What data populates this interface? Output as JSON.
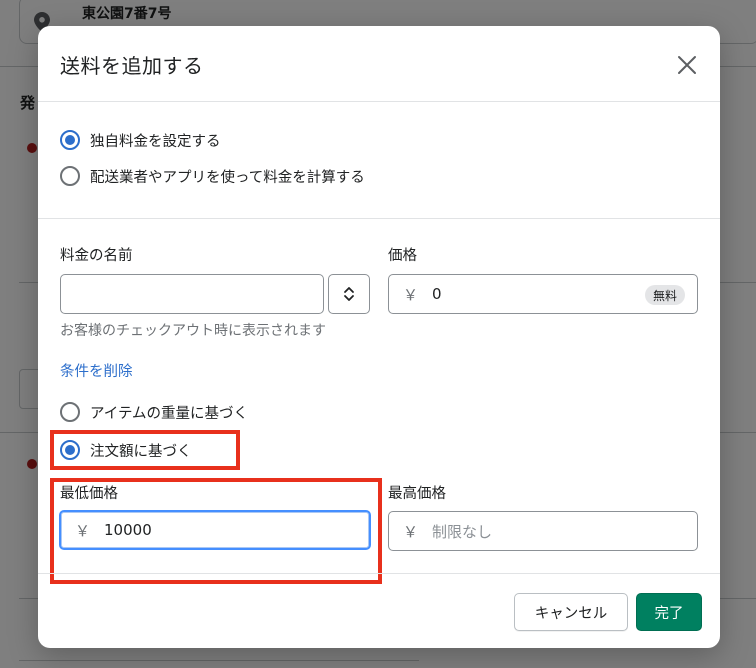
{
  "background": {
    "address": "東公園7番7号",
    "heading_fragment": "発"
  },
  "modal": {
    "title": "送料を追加する",
    "rate_type_options": [
      {
        "label": "独自料金を設定する",
        "checked": true
      },
      {
        "label": "配送業者やアプリを使って料金を計算する",
        "checked": false
      }
    ],
    "rate_name": {
      "label": "料金の名前",
      "value": "",
      "help_text": "お客様のチェックアウト時に表示されます"
    },
    "price": {
      "label": "価格",
      "currency": "￥",
      "value": "0",
      "badge": "無料"
    },
    "remove_conditions_link": "条件を削除",
    "condition_options": [
      {
        "label": "アイテムの重量に基づく",
        "checked": false
      },
      {
        "label": "注文額に基づく",
        "checked": true
      }
    ],
    "min_price": {
      "label": "最低価格",
      "currency": "￥",
      "value": "10000"
    },
    "max_price": {
      "label": "最高価格",
      "currency": "￥",
      "placeholder": "制限なし"
    },
    "buttons": {
      "cancel": "キャンセル",
      "done": "完了"
    }
  },
  "colors": {
    "accent": "#2c6ecb",
    "primary_button": "#008060",
    "highlight": "#e8301c"
  },
  "icons": {
    "close": "close-icon",
    "stepper": "stepper-arrows-icon",
    "location": "location-pin-icon"
  }
}
